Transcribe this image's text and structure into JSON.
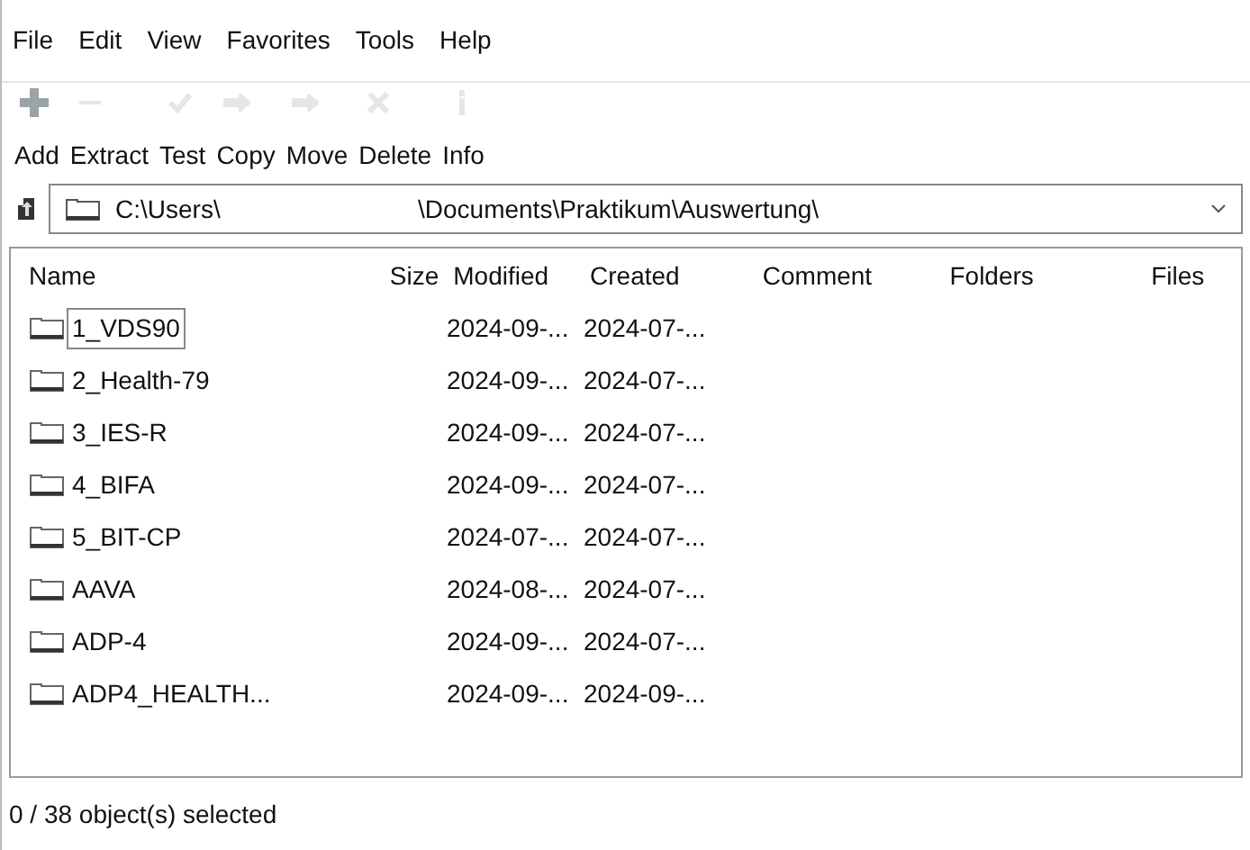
{
  "menu": [
    "File",
    "Edit",
    "View",
    "Favorites",
    "Tools",
    "Help"
  ],
  "toolbar": [
    {
      "label": "Add",
      "disabled": false
    },
    {
      "label": "Extract",
      "disabled": true
    },
    {
      "label": "Test",
      "disabled": true
    },
    {
      "label": "Copy",
      "disabled": true
    },
    {
      "label": "Move",
      "disabled": true
    },
    {
      "label": "Delete",
      "disabled": true
    },
    {
      "label": "Info",
      "disabled": true
    }
  ],
  "address": {
    "parts": [
      "C:\\Users\\",
      "\\Documents\\Praktikum\\Auswertung\\"
    ]
  },
  "table": {
    "columns": [
      "Name",
      "Size",
      "Modified",
      "Created",
      "Comment",
      "Folders",
      "Files"
    ],
    "rows": [
      {
        "name": "1_VDS90",
        "modified": "2024-09-...",
        "created": "2024-07-...",
        "focused": true
      },
      {
        "name": "2_Health-79",
        "modified": "2024-09-...",
        "created": "2024-07-...",
        "focused": false
      },
      {
        "name": "3_IES-R",
        "modified": "2024-09-...",
        "created": "2024-07-...",
        "focused": false
      },
      {
        "name": "4_BIFA",
        "modified": "2024-09-...",
        "created": "2024-07-...",
        "focused": false
      },
      {
        "name": "5_BIT-CP",
        "modified": "2024-07-...",
        "created": "2024-07-...",
        "focused": false
      },
      {
        "name": "AAVA",
        "modified": "2024-08-...",
        "created": "2024-07-...",
        "focused": false
      },
      {
        "name": "ADP-4",
        "modified": "2024-09-...",
        "created": "2024-07-...",
        "focused": false
      },
      {
        "name": "ADP4_HEALTH...",
        "modified": "2024-09-...",
        "created": "2024-09-...",
        "focused": false
      }
    ]
  },
  "status_bar": "0 / 38 object(s) selected"
}
